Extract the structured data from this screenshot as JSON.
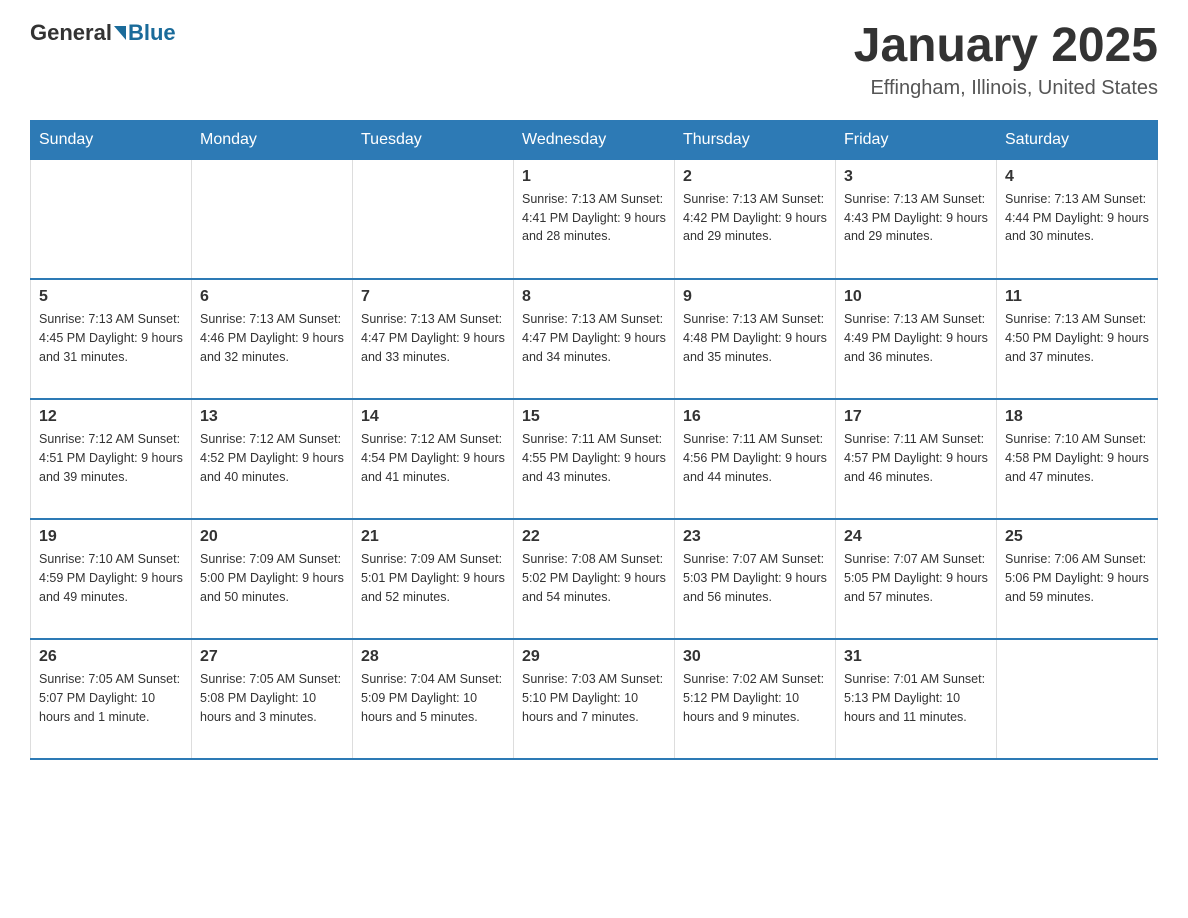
{
  "header": {
    "logo_general": "General",
    "logo_blue": "Blue",
    "month_title": "January 2025",
    "location": "Effingham, Illinois, United States"
  },
  "days_of_week": [
    "Sunday",
    "Monday",
    "Tuesday",
    "Wednesday",
    "Thursday",
    "Friday",
    "Saturday"
  ],
  "weeks": [
    [
      {
        "day": "",
        "info": ""
      },
      {
        "day": "",
        "info": ""
      },
      {
        "day": "",
        "info": ""
      },
      {
        "day": "1",
        "info": "Sunrise: 7:13 AM\nSunset: 4:41 PM\nDaylight: 9 hours and 28 minutes."
      },
      {
        "day": "2",
        "info": "Sunrise: 7:13 AM\nSunset: 4:42 PM\nDaylight: 9 hours and 29 minutes."
      },
      {
        "day": "3",
        "info": "Sunrise: 7:13 AM\nSunset: 4:43 PM\nDaylight: 9 hours and 29 minutes."
      },
      {
        "day": "4",
        "info": "Sunrise: 7:13 AM\nSunset: 4:44 PM\nDaylight: 9 hours and 30 minutes."
      }
    ],
    [
      {
        "day": "5",
        "info": "Sunrise: 7:13 AM\nSunset: 4:45 PM\nDaylight: 9 hours and 31 minutes."
      },
      {
        "day": "6",
        "info": "Sunrise: 7:13 AM\nSunset: 4:46 PM\nDaylight: 9 hours and 32 minutes."
      },
      {
        "day": "7",
        "info": "Sunrise: 7:13 AM\nSunset: 4:47 PM\nDaylight: 9 hours and 33 minutes."
      },
      {
        "day": "8",
        "info": "Sunrise: 7:13 AM\nSunset: 4:47 PM\nDaylight: 9 hours and 34 minutes."
      },
      {
        "day": "9",
        "info": "Sunrise: 7:13 AM\nSunset: 4:48 PM\nDaylight: 9 hours and 35 minutes."
      },
      {
        "day": "10",
        "info": "Sunrise: 7:13 AM\nSunset: 4:49 PM\nDaylight: 9 hours and 36 minutes."
      },
      {
        "day": "11",
        "info": "Sunrise: 7:13 AM\nSunset: 4:50 PM\nDaylight: 9 hours and 37 minutes."
      }
    ],
    [
      {
        "day": "12",
        "info": "Sunrise: 7:12 AM\nSunset: 4:51 PM\nDaylight: 9 hours and 39 minutes."
      },
      {
        "day": "13",
        "info": "Sunrise: 7:12 AM\nSunset: 4:52 PM\nDaylight: 9 hours and 40 minutes."
      },
      {
        "day": "14",
        "info": "Sunrise: 7:12 AM\nSunset: 4:54 PM\nDaylight: 9 hours and 41 minutes."
      },
      {
        "day": "15",
        "info": "Sunrise: 7:11 AM\nSunset: 4:55 PM\nDaylight: 9 hours and 43 minutes."
      },
      {
        "day": "16",
        "info": "Sunrise: 7:11 AM\nSunset: 4:56 PM\nDaylight: 9 hours and 44 minutes."
      },
      {
        "day": "17",
        "info": "Sunrise: 7:11 AM\nSunset: 4:57 PM\nDaylight: 9 hours and 46 minutes."
      },
      {
        "day": "18",
        "info": "Sunrise: 7:10 AM\nSunset: 4:58 PM\nDaylight: 9 hours and 47 minutes."
      }
    ],
    [
      {
        "day": "19",
        "info": "Sunrise: 7:10 AM\nSunset: 4:59 PM\nDaylight: 9 hours and 49 minutes."
      },
      {
        "day": "20",
        "info": "Sunrise: 7:09 AM\nSunset: 5:00 PM\nDaylight: 9 hours and 50 minutes."
      },
      {
        "day": "21",
        "info": "Sunrise: 7:09 AM\nSunset: 5:01 PM\nDaylight: 9 hours and 52 minutes."
      },
      {
        "day": "22",
        "info": "Sunrise: 7:08 AM\nSunset: 5:02 PM\nDaylight: 9 hours and 54 minutes."
      },
      {
        "day": "23",
        "info": "Sunrise: 7:07 AM\nSunset: 5:03 PM\nDaylight: 9 hours and 56 minutes."
      },
      {
        "day": "24",
        "info": "Sunrise: 7:07 AM\nSunset: 5:05 PM\nDaylight: 9 hours and 57 minutes."
      },
      {
        "day": "25",
        "info": "Sunrise: 7:06 AM\nSunset: 5:06 PM\nDaylight: 9 hours and 59 minutes."
      }
    ],
    [
      {
        "day": "26",
        "info": "Sunrise: 7:05 AM\nSunset: 5:07 PM\nDaylight: 10 hours and 1 minute."
      },
      {
        "day": "27",
        "info": "Sunrise: 7:05 AM\nSunset: 5:08 PM\nDaylight: 10 hours and 3 minutes."
      },
      {
        "day": "28",
        "info": "Sunrise: 7:04 AM\nSunset: 5:09 PM\nDaylight: 10 hours and 5 minutes."
      },
      {
        "day": "29",
        "info": "Sunrise: 7:03 AM\nSunset: 5:10 PM\nDaylight: 10 hours and 7 minutes."
      },
      {
        "day": "30",
        "info": "Sunrise: 7:02 AM\nSunset: 5:12 PM\nDaylight: 10 hours and 9 minutes."
      },
      {
        "day": "31",
        "info": "Sunrise: 7:01 AM\nSunset: 5:13 PM\nDaylight: 10 hours and 11 minutes."
      },
      {
        "day": "",
        "info": ""
      }
    ]
  ]
}
